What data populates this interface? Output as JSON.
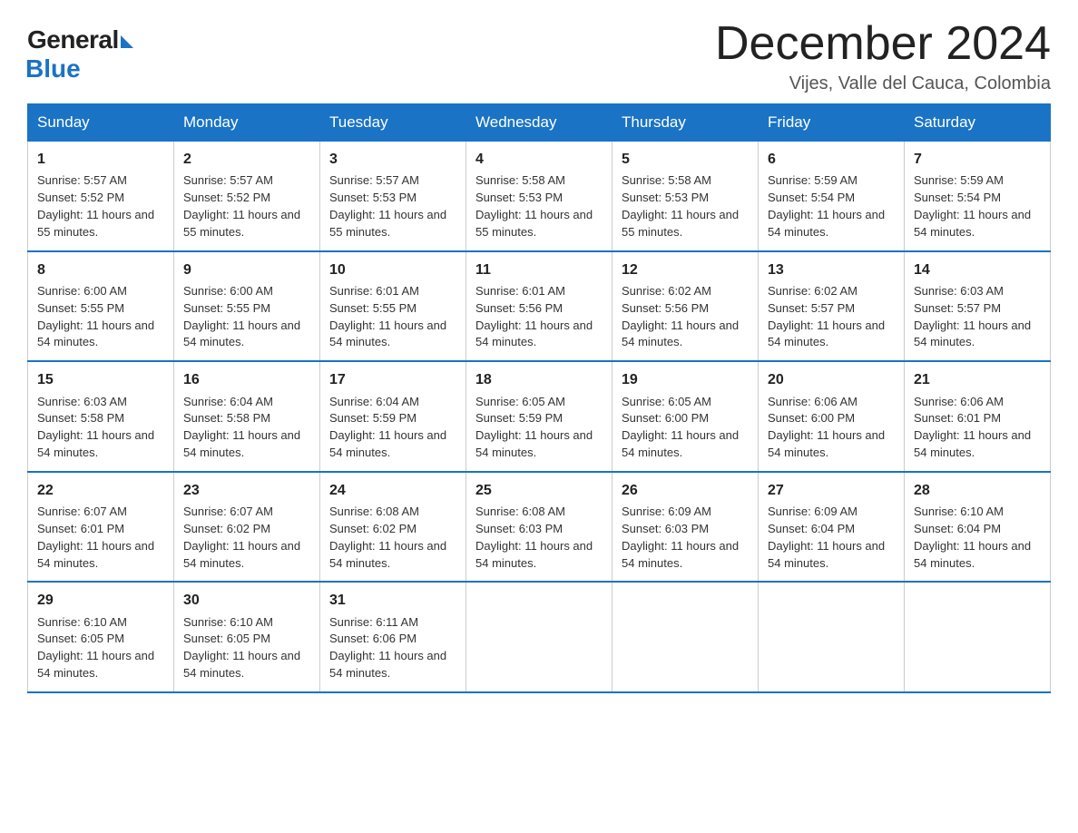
{
  "logo": {
    "general": "General",
    "blue": "Blue"
  },
  "header": {
    "title": "December 2024",
    "subtitle": "Vijes, Valle del Cauca, Colombia"
  },
  "weekdays": [
    "Sunday",
    "Monday",
    "Tuesday",
    "Wednesday",
    "Thursday",
    "Friday",
    "Saturday"
  ],
  "weeks": [
    [
      {
        "day": "1",
        "sunrise": "5:57 AM",
        "sunset": "5:52 PM",
        "daylight": "11 hours and 55 minutes."
      },
      {
        "day": "2",
        "sunrise": "5:57 AM",
        "sunset": "5:52 PM",
        "daylight": "11 hours and 55 minutes."
      },
      {
        "day": "3",
        "sunrise": "5:57 AM",
        "sunset": "5:53 PM",
        "daylight": "11 hours and 55 minutes."
      },
      {
        "day": "4",
        "sunrise": "5:58 AM",
        "sunset": "5:53 PM",
        "daylight": "11 hours and 55 minutes."
      },
      {
        "day": "5",
        "sunrise": "5:58 AM",
        "sunset": "5:53 PM",
        "daylight": "11 hours and 55 minutes."
      },
      {
        "day": "6",
        "sunrise": "5:59 AM",
        "sunset": "5:54 PM",
        "daylight": "11 hours and 54 minutes."
      },
      {
        "day": "7",
        "sunrise": "5:59 AM",
        "sunset": "5:54 PM",
        "daylight": "11 hours and 54 minutes."
      }
    ],
    [
      {
        "day": "8",
        "sunrise": "6:00 AM",
        "sunset": "5:55 PM",
        "daylight": "11 hours and 54 minutes."
      },
      {
        "day": "9",
        "sunrise": "6:00 AM",
        "sunset": "5:55 PM",
        "daylight": "11 hours and 54 minutes."
      },
      {
        "day": "10",
        "sunrise": "6:01 AM",
        "sunset": "5:55 PM",
        "daylight": "11 hours and 54 minutes."
      },
      {
        "day": "11",
        "sunrise": "6:01 AM",
        "sunset": "5:56 PM",
        "daylight": "11 hours and 54 minutes."
      },
      {
        "day": "12",
        "sunrise": "6:02 AM",
        "sunset": "5:56 PM",
        "daylight": "11 hours and 54 minutes."
      },
      {
        "day": "13",
        "sunrise": "6:02 AM",
        "sunset": "5:57 PM",
        "daylight": "11 hours and 54 minutes."
      },
      {
        "day": "14",
        "sunrise": "6:03 AM",
        "sunset": "5:57 PM",
        "daylight": "11 hours and 54 minutes."
      }
    ],
    [
      {
        "day": "15",
        "sunrise": "6:03 AM",
        "sunset": "5:58 PM",
        "daylight": "11 hours and 54 minutes."
      },
      {
        "day": "16",
        "sunrise": "6:04 AM",
        "sunset": "5:58 PM",
        "daylight": "11 hours and 54 minutes."
      },
      {
        "day": "17",
        "sunrise": "6:04 AM",
        "sunset": "5:59 PM",
        "daylight": "11 hours and 54 minutes."
      },
      {
        "day": "18",
        "sunrise": "6:05 AM",
        "sunset": "5:59 PM",
        "daylight": "11 hours and 54 minutes."
      },
      {
        "day": "19",
        "sunrise": "6:05 AM",
        "sunset": "6:00 PM",
        "daylight": "11 hours and 54 minutes."
      },
      {
        "day": "20",
        "sunrise": "6:06 AM",
        "sunset": "6:00 PM",
        "daylight": "11 hours and 54 minutes."
      },
      {
        "day": "21",
        "sunrise": "6:06 AM",
        "sunset": "6:01 PM",
        "daylight": "11 hours and 54 minutes."
      }
    ],
    [
      {
        "day": "22",
        "sunrise": "6:07 AM",
        "sunset": "6:01 PM",
        "daylight": "11 hours and 54 minutes."
      },
      {
        "day": "23",
        "sunrise": "6:07 AM",
        "sunset": "6:02 PM",
        "daylight": "11 hours and 54 minutes."
      },
      {
        "day": "24",
        "sunrise": "6:08 AM",
        "sunset": "6:02 PM",
        "daylight": "11 hours and 54 minutes."
      },
      {
        "day": "25",
        "sunrise": "6:08 AM",
        "sunset": "6:03 PM",
        "daylight": "11 hours and 54 minutes."
      },
      {
        "day": "26",
        "sunrise": "6:09 AM",
        "sunset": "6:03 PM",
        "daylight": "11 hours and 54 minutes."
      },
      {
        "day": "27",
        "sunrise": "6:09 AM",
        "sunset": "6:04 PM",
        "daylight": "11 hours and 54 minutes."
      },
      {
        "day": "28",
        "sunrise": "6:10 AM",
        "sunset": "6:04 PM",
        "daylight": "11 hours and 54 minutes."
      }
    ],
    [
      {
        "day": "29",
        "sunrise": "6:10 AM",
        "sunset": "6:05 PM",
        "daylight": "11 hours and 54 minutes."
      },
      {
        "day": "30",
        "sunrise": "6:10 AM",
        "sunset": "6:05 PM",
        "daylight": "11 hours and 54 minutes."
      },
      {
        "day": "31",
        "sunrise": "6:11 AM",
        "sunset": "6:06 PM",
        "daylight": "11 hours and 54 minutes."
      },
      null,
      null,
      null,
      null
    ]
  ]
}
